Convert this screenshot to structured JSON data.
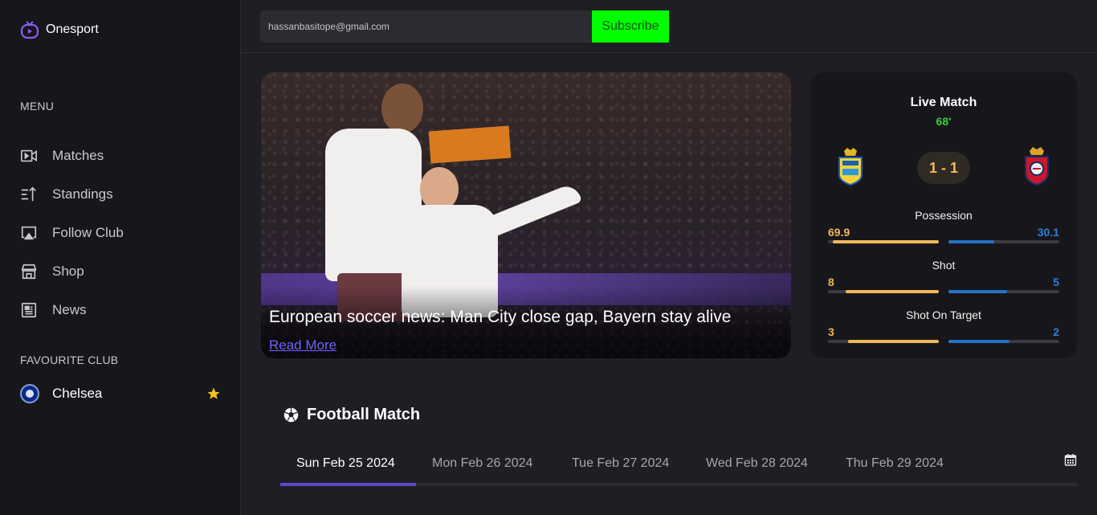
{
  "brand": {
    "name": "Onesport",
    "accent": "#7c3aed"
  },
  "topbar": {
    "email_value": "hassanbasitope@gmail.com",
    "subscribe_label": "Subscribe",
    "subscribe_color": "#00ff00"
  },
  "sidebar": {
    "menu_heading": "MENU",
    "items": [
      {
        "label": "Matches",
        "icon": "video-icon"
      },
      {
        "label": "Standings",
        "icon": "sort-icon"
      },
      {
        "label": "Follow Club",
        "icon": "cast-icon"
      },
      {
        "label": "Shop",
        "icon": "store-icon"
      },
      {
        "label": "News",
        "icon": "newspaper-icon"
      }
    ],
    "favourite_heading": "FAVOURITE CLUB",
    "favourite": {
      "name": "Chelsea",
      "icon": "star-icon",
      "star_color": "#f5c518"
    }
  },
  "hero": {
    "title": "European soccer news: Man City close gap, Bayern stay alive",
    "read_more": "Read More"
  },
  "live": {
    "title": "Live Match",
    "minute": "68'",
    "score": "1 - 1",
    "stats": [
      {
        "label": "Possession",
        "home": "69.9",
        "away": "30.1",
        "home_ratio": 0.699,
        "away_ratio": 0.301
      },
      {
        "label": "Shot",
        "home": "8",
        "away": "5",
        "home_ratio": 0.615,
        "away_ratio": 0.385
      },
      {
        "label": "Shot On Target",
        "home": "3",
        "away": "2",
        "home_ratio": 0.6,
        "away_ratio": 0.4
      }
    ],
    "home_color": "#f0b85a",
    "away_color": "#2474c6"
  },
  "matches": {
    "title": "Football Match",
    "tabs": [
      "Sun Feb 25 2024",
      "Mon Feb 26 2024",
      "Tue Feb 27 2024",
      "Wed Feb 28 2024",
      "Thu Feb 29 2024"
    ],
    "active_tab": 0
  }
}
